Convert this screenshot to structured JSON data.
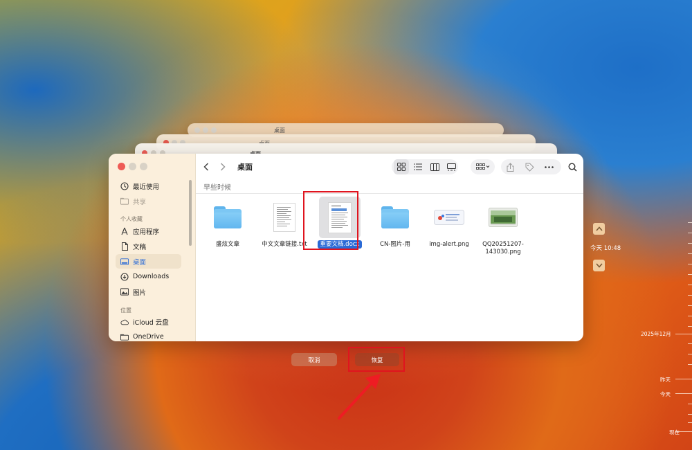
{
  "back_windows": [
    {
      "title": "桌面"
    },
    {
      "title": "桌面"
    },
    {
      "title": "桌面"
    }
  ],
  "window": {
    "title": "桌面",
    "section_header": "早些时候"
  },
  "sidebar": {
    "items": [
      {
        "label": "最近使用",
        "icon": "clock-icon"
      },
      {
        "label": "共享",
        "icon": "shared-folder-icon"
      }
    ],
    "favorites_header": "个人收藏",
    "favorites": [
      {
        "label": "应用程序",
        "icon": "applications-icon"
      },
      {
        "label": "文稿",
        "icon": "document-icon"
      },
      {
        "label": "桌面",
        "icon": "desktop-icon"
      },
      {
        "label": "Downloads",
        "icon": "download-icon"
      },
      {
        "label": "图片",
        "icon": "photo-icon"
      }
    ],
    "locations_header": "位置",
    "locations": [
      {
        "label": "iCloud 云盘",
        "icon": "cloud-icon"
      },
      {
        "label": "OneDrive",
        "icon": "folder-icon"
      }
    ]
  },
  "files": [
    {
      "name": "盛炫文章",
      "type": "folder"
    },
    {
      "name": "中文文章链接.txt",
      "type": "text"
    },
    {
      "name": "重要文档.docx",
      "type": "docx",
      "selected": true
    },
    {
      "name": "CN-图片-用",
      "type": "folder"
    },
    {
      "name": "img-alert.png",
      "type": "image"
    },
    {
      "name": "QQ20251207-143030.png",
      "type": "image"
    }
  ],
  "buttons": {
    "cancel": "取消",
    "restore": "恢复"
  },
  "timeline": {
    "current_time": "今天 10:48",
    "ticks": [
      {
        "label": "2025年12月"
      },
      {
        "label": "昨天"
      },
      {
        "label": "今天"
      },
      {
        "label": "现在"
      }
    ]
  },
  "colors": {
    "accent": "#2a6ad6",
    "highlight": "#e0141e"
  }
}
